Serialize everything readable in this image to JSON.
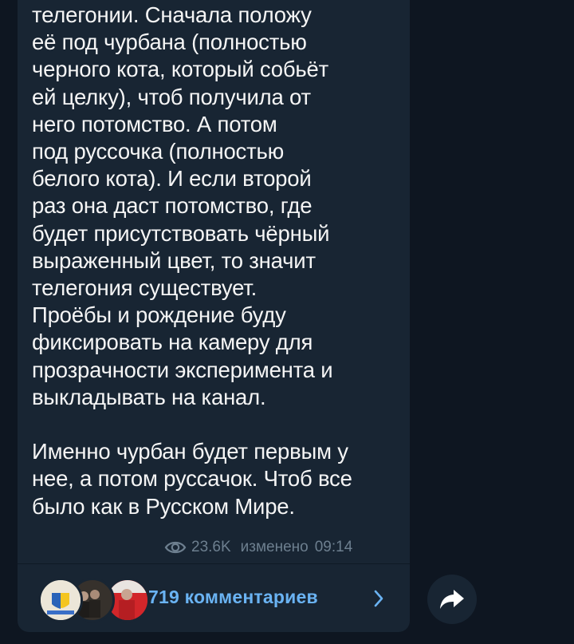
{
  "message": {
    "lines": [
      "телегонии. Сначала положу",
      "её под чурбана (полностью",
      "черного кота, который собьёт",
      "ей целку), чтоб получила от",
      "него потомство. А потом",
      "под руссочка (полностью",
      "белого кота). И если второй",
      "раз она даст потомство, где",
      "будет присутствовать чёрный",
      "выраженный цвет, то значит",
      "телегония существует.",
      "Проёбы и рождение буду",
      "фиксировать на камеру для",
      "прозрачности эксперимента и",
      "выкладывать на канал."
    ],
    "lines2": [
      "Именно чурбан будет первым у",
      "нее, а потом руссачок. Чтоб все",
      "было как в Русском Мире."
    ],
    "views": "23.6K",
    "edited_label": "изменено",
    "time": "09:14"
  },
  "comments": {
    "label": "719 комментариев",
    "avatar_icons": [
      "user-avatar",
      "user-avatar",
      "user-avatar"
    ]
  },
  "share_button": {
    "icon": "share-arrow-icon"
  },
  "colors": {
    "background": "#0e1621",
    "bubble": "#182533",
    "text": "#f5f5f5",
    "meta": "#6d7f8f",
    "accent": "#6ab3f3"
  }
}
